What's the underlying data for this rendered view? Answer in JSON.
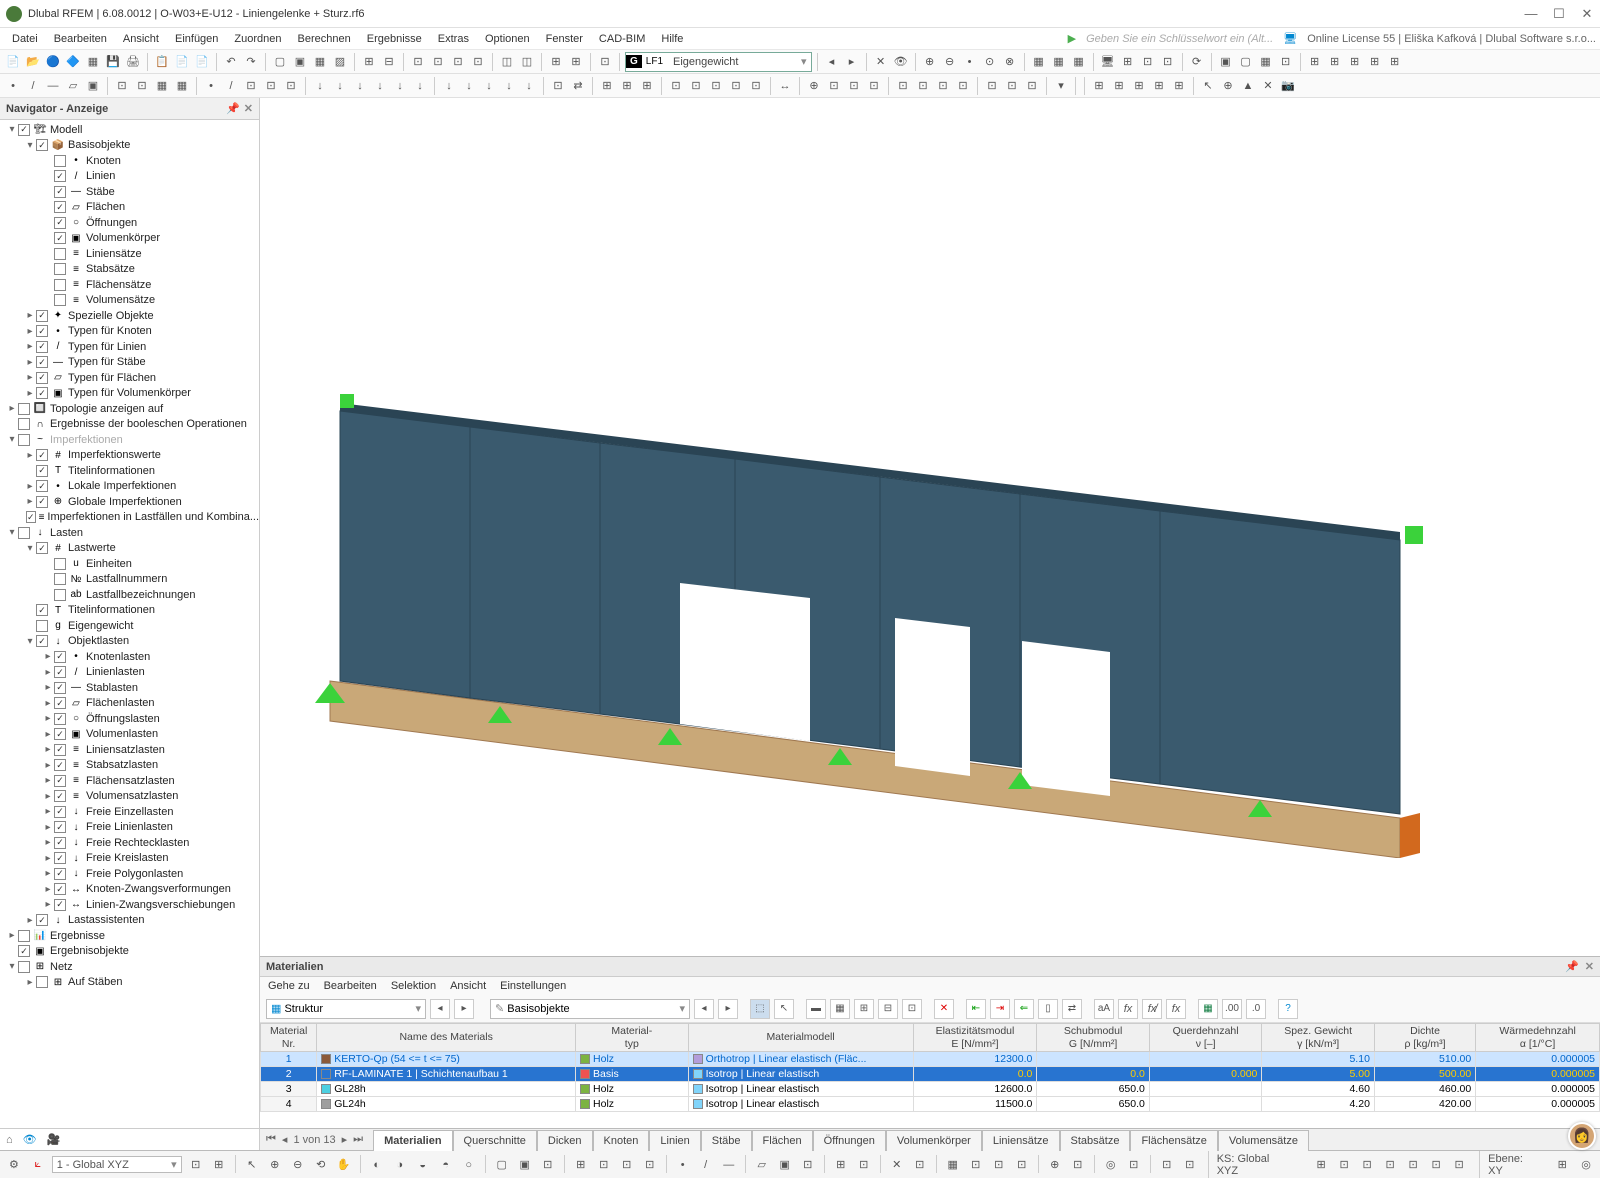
{
  "title": "Dlubal RFEM | 6.08.0012 | O-W03+E-U12 - Liniengelenke + Sturz.rf6",
  "license": "Online License 55 | Eliška Kafková | Dlubal Software s.r.o...",
  "search_placeholder": "Geben Sie ein Schlüsselwort ein (Alt...",
  "menu": [
    "Datei",
    "Bearbeiten",
    "Ansicht",
    "Einfügen",
    "Zuordnen",
    "Berechnen",
    "Ergebnisse",
    "Extras",
    "Optionen",
    "Fenster",
    "CAD-BIM",
    "Hilfe"
  ],
  "lf": {
    "tag": "G",
    "code": "LF1",
    "name": "Eigengewicht"
  },
  "navigator": {
    "title": "Navigator - Anzeige",
    "items": [
      {
        "d": 0,
        "tw": "▾",
        "chk": true,
        "ic": "🏗",
        "lbl": "Modell"
      },
      {
        "d": 1,
        "tw": "▾",
        "chk": true,
        "ic": "📦",
        "lbl": "Basisobjekte",
        "iccol": "#8bc34a"
      },
      {
        "d": 2,
        "tw": "",
        "chk": false,
        "ic": "•",
        "lbl": "Knoten"
      },
      {
        "d": 2,
        "tw": "",
        "chk": true,
        "ic": "/",
        "lbl": "Linien"
      },
      {
        "d": 2,
        "tw": "",
        "chk": true,
        "ic": "—",
        "lbl": "Stäbe"
      },
      {
        "d": 2,
        "tw": "",
        "chk": true,
        "ic": "▱",
        "lbl": "Flächen"
      },
      {
        "d": 2,
        "tw": "",
        "chk": true,
        "ic": "○",
        "lbl": "Öffnungen"
      },
      {
        "d": 2,
        "tw": "",
        "chk": true,
        "ic": "▣",
        "lbl": "Volumenkörper"
      },
      {
        "d": 2,
        "tw": "",
        "chk": false,
        "ic": "≡",
        "lbl": "Liniensätze"
      },
      {
        "d": 2,
        "tw": "",
        "chk": false,
        "ic": "≡",
        "lbl": "Stabsätze"
      },
      {
        "d": 2,
        "tw": "",
        "chk": false,
        "ic": "≡",
        "lbl": "Flächensätze"
      },
      {
        "d": 2,
        "tw": "",
        "chk": false,
        "ic": "≡",
        "lbl": "Volumensätze"
      },
      {
        "d": 1,
        "tw": "▸",
        "chk": true,
        "ic": "✦",
        "lbl": "Spezielle Objekte"
      },
      {
        "d": 1,
        "tw": "▸",
        "chk": true,
        "ic": "•",
        "lbl": "Typen für Knoten"
      },
      {
        "d": 1,
        "tw": "▸",
        "chk": true,
        "ic": "/",
        "lbl": "Typen für Linien"
      },
      {
        "d": 1,
        "tw": "▸",
        "chk": true,
        "ic": "—",
        "lbl": "Typen für Stäbe"
      },
      {
        "d": 1,
        "tw": "▸",
        "chk": true,
        "ic": "▱",
        "lbl": "Typen für Flächen"
      },
      {
        "d": 1,
        "tw": "▸",
        "chk": true,
        "ic": "▣",
        "lbl": "Typen für Volumenkörper"
      },
      {
        "d": 0,
        "tw": "▸",
        "chk": false,
        "ic": "🔲",
        "lbl": "Topologie anzeigen auf"
      },
      {
        "d": 0,
        "tw": "",
        "chk": false,
        "ic": "∩",
        "lbl": "Ergebnisse der booleschen Operationen"
      },
      {
        "d": 0,
        "tw": "▾",
        "chk": false,
        "ic": "~",
        "lbl": "Imperfektionen",
        "dim": true
      },
      {
        "d": 1,
        "tw": "▸",
        "chk": true,
        "ic": "#",
        "lbl": "Imperfektionswerte"
      },
      {
        "d": 1,
        "tw": "",
        "chk": true,
        "ic": "T",
        "lbl": "Titelinformationen"
      },
      {
        "d": 1,
        "tw": "▸",
        "chk": true,
        "ic": "•",
        "lbl": "Lokale Imperfektionen"
      },
      {
        "d": 1,
        "tw": "▸",
        "chk": true,
        "ic": "⊕",
        "lbl": "Globale Imperfektionen"
      },
      {
        "d": 1,
        "tw": "",
        "chk": true,
        "ic": "≡",
        "lbl": "Imperfektionen in Lastfällen und Kombina..."
      },
      {
        "d": 0,
        "tw": "▾",
        "chk": false,
        "ic": "↓",
        "lbl": "Lasten"
      },
      {
        "d": 1,
        "tw": "▾",
        "chk": true,
        "ic": "#",
        "lbl": "Lastwerte"
      },
      {
        "d": 2,
        "tw": "",
        "chk": false,
        "ic": "u",
        "lbl": "Einheiten"
      },
      {
        "d": 2,
        "tw": "",
        "chk": false,
        "ic": "№",
        "lbl": "Lastfallnummern"
      },
      {
        "d": 2,
        "tw": "",
        "chk": false,
        "ic": "ab",
        "lbl": "Lastfallbezeichnungen"
      },
      {
        "d": 1,
        "tw": "",
        "chk": true,
        "ic": "T",
        "lbl": "Titelinformationen"
      },
      {
        "d": 1,
        "tw": "",
        "chk": false,
        "ic": "g",
        "lbl": "Eigengewicht"
      },
      {
        "d": 1,
        "tw": "▾",
        "chk": true,
        "ic": "↓",
        "lbl": "Objektlasten"
      },
      {
        "d": 2,
        "tw": "▸",
        "chk": true,
        "ic": "•",
        "lbl": "Knotenlasten"
      },
      {
        "d": 2,
        "tw": "▸",
        "chk": true,
        "ic": "/",
        "lbl": "Linienlasten"
      },
      {
        "d": 2,
        "tw": "▸",
        "chk": true,
        "ic": "—",
        "lbl": "Stablasten"
      },
      {
        "d": 2,
        "tw": "▸",
        "chk": true,
        "ic": "▱",
        "lbl": "Flächenlasten"
      },
      {
        "d": 2,
        "tw": "▸",
        "chk": true,
        "ic": "○",
        "lbl": "Öffnungslasten"
      },
      {
        "d": 2,
        "tw": "▸",
        "chk": true,
        "ic": "▣",
        "lbl": "Volumenlasten"
      },
      {
        "d": 2,
        "tw": "▸",
        "chk": true,
        "ic": "≡",
        "lbl": "Liniensatzlasten"
      },
      {
        "d": 2,
        "tw": "▸",
        "chk": true,
        "ic": "≡",
        "lbl": "Stabsatzlasten"
      },
      {
        "d": 2,
        "tw": "▸",
        "chk": true,
        "ic": "≡",
        "lbl": "Flächensatzlasten"
      },
      {
        "d": 2,
        "tw": "▸",
        "chk": true,
        "ic": "≡",
        "lbl": "Volumensatzlasten"
      },
      {
        "d": 2,
        "tw": "▸",
        "chk": true,
        "ic": "↓",
        "lbl": "Freie Einzellasten"
      },
      {
        "d": 2,
        "tw": "▸",
        "chk": true,
        "ic": "↓",
        "lbl": "Freie Linienlasten"
      },
      {
        "d": 2,
        "tw": "▸",
        "chk": true,
        "ic": "↓",
        "lbl": "Freie Rechtecklasten"
      },
      {
        "d": 2,
        "tw": "▸",
        "chk": true,
        "ic": "↓",
        "lbl": "Freie Kreislasten"
      },
      {
        "d": 2,
        "tw": "▸",
        "chk": true,
        "ic": "↓",
        "lbl": "Freie Polygonlasten"
      },
      {
        "d": 2,
        "tw": "▸",
        "chk": true,
        "ic": "↔",
        "lbl": "Knoten-Zwangsverformungen"
      },
      {
        "d": 2,
        "tw": "▸",
        "chk": true,
        "ic": "↔",
        "lbl": "Linien-Zwangsverschiebungen"
      },
      {
        "d": 1,
        "tw": "▸",
        "chk": true,
        "ic": "↓",
        "lbl": "Lastassistenten"
      },
      {
        "d": 0,
        "tw": "▸",
        "chk": false,
        "ic": "📊",
        "lbl": "Ergebnisse"
      },
      {
        "d": 0,
        "tw": "",
        "chk": true,
        "ic": "▣",
        "lbl": "Ergebnisobjekte"
      },
      {
        "d": 0,
        "tw": "▾",
        "chk": false,
        "ic": "⊞",
        "lbl": "Netz"
      },
      {
        "d": 1,
        "tw": "▸",
        "chk": false,
        "ic": "⊞",
        "lbl": "Auf Stäben"
      }
    ]
  },
  "materials": {
    "title": "Materialien",
    "menu": [
      "Gehe zu",
      "Bearbeiten",
      "Selektion",
      "Ansicht",
      "Einstellungen"
    ],
    "combo1": "Struktur",
    "combo2": "Basisobjekte",
    "headers": [
      "Material\nNr.",
      "Name des Materials",
      "Material-\ntyp",
      "Materialmodell",
      "Elastizitätsmodul\nE [N/mm²]",
      "Schubmodul\nG [N/mm²]",
      "Querdehnzahl\nν [–]",
      "Spez. Gewicht\nγ [kN/m³]",
      "Dichte\nρ [kg/m³]",
      "Wärmedehnzahl\nα [1/°C]"
    ],
    "rows": [
      {
        "nr": "1",
        "name": "KERTO-Qp (54 <= t <= 75)",
        "sw": "#8b5a3a",
        "typ": "Holz",
        "typsw": "#7cb342",
        "model": "Orthotrop | Linear elastisch (Fläc...",
        "msw": "#b39ddb",
        "E": "12300.0",
        "G": "",
        "v": "",
        "gamma": "5.10",
        "rho": "510.00",
        "alpha": "0.000005",
        "cls": "r1"
      },
      {
        "nr": "2",
        "name": "RF-LAMINATE 1 | Schichtenaufbau 1",
        "sw": "#2874d0",
        "typ": "Basis",
        "typsw": "#ef5350",
        "model": "Isotrop | Linear elastisch",
        "msw": "#81d4fa",
        "E": "0.0",
        "G": "0.0",
        "v": "0.000",
        "gamma": "5.00",
        "rho": "500.00",
        "alpha": "0.000005",
        "cls": "r2"
      },
      {
        "nr": "3",
        "name": "GL28h",
        "sw": "#4dd0e1",
        "typ": "Holz",
        "typsw": "#7cb342",
        "model": "Isotrop | Linear elastisch",
        "msw": "#81d4fa",
        "E": "12600.0",
        "G": "650.0",
        "v": "",
        "gamma": "4.60",
        "rho": "460.00",
        "alpha": "0.000005",
        "cls": ""
      },
      {
        "nr": "4",
        "name": "GL24h",
        "sw": "#9e9e9e",
        "typ": "Holz",
        "typsw": "#7cb342",
        "model": "Isotrop | Linear elastisch",
        "msw": "#81d4fa",
        "E": "11500.0",
        "G": "650.0",
        "v": "",
        "gamma": "4.20",
        "rho": "420.00",
        "alpha": "0.000005",
        "cls": ""
      }
    ]
  },
  "tabs": {
    "page": "1 von 13",
    "items": [
      "Materialien",
      "Querschnitte",
      "Dicken",
      "Knoten",
      "Linien",
      "Stäbe",
      "Flächen",
      "Öffnungen",
      "Volumenkörper",
      "Liniensätze",
      "Stabsätze",
      "Flächensätze",
      "Volumensätze"
    ],
    "active": 0
  },
  "status": {
    "coord": "1 - Global XYZ",
    "ks": "KS: Global XYZ",
    "ebene": "Ebene: XY"
  }
}
